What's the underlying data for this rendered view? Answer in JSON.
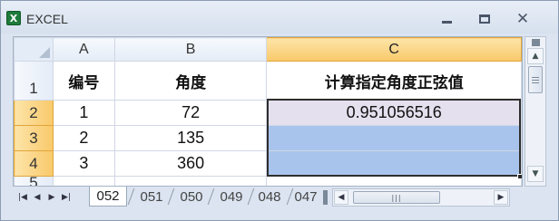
{
  "window": {
    "title": "EXCEL",
    "app_icon": "excel-icon",
    "controls": {
      "minimize": "minimize-icon",
      "maximize": "maximize-icon",
      "close": "✕"
    }
  },
  "sheet": {
    "columns": [
      "A",
      "B",
      "C"
    ],
    "selected_column": "C",
    "rows": [
      {
        "num": "1",
        "a": "编号",
        "b": "角度",
        "c": "计算指定角度正弦值"
      },
      {
        "num": "2",
        "a": "1",
        "b": "72",
        "c": "0.951056516"
      },
      {
        "num": "3",
        "a": "2",
        "b": "135",
        "c": ""
      },
      {
        "num": "4",
        "a": "3",
        "b": "360",
        "c": ""
      },
      {
        "num": "5",
        "a": "",
        "b": "",
        "c": ""
      }
    ],
    "selected_rows": [
      "2",
      "3",
      "4"
    ]
  },
  "tabs": {
    "items": [
      "052",
      "051",
      "050",
      "049",
      "048",
      "047"
    ],
    "active": "052",
    "nav": [
      "|◀",
      "◀",
      "▶",
      "▶|"
    ]
  },
  "colors": {
    "selected_header": "#f9c96b",
    "selection_fill": "#a9c4ec",
    "active_cell_fill": "#e4e0ee"
  }
}
